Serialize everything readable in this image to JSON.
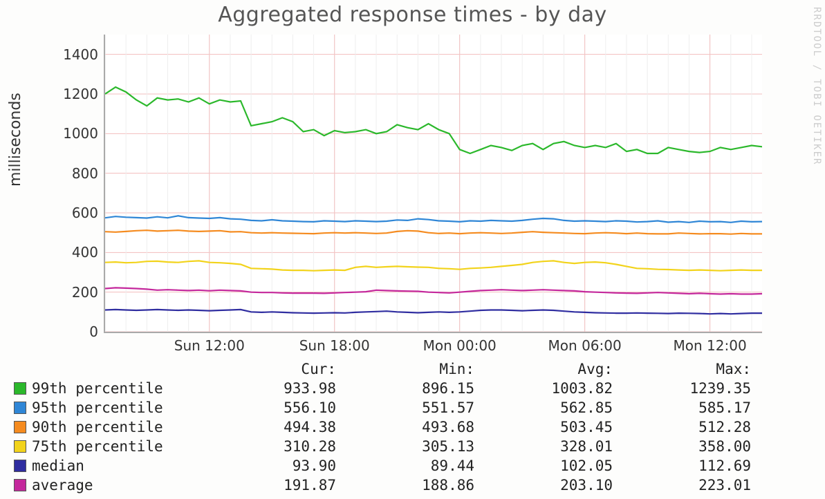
{
  "title": "Aggregated response times - by day",
  "ylabel": "milliseconds",
  "watermark": "RRDTOOL / TOBI OETIKER",
  "yticks": [
    "0",
    "200",
    "400",
    "600",
    "800",
    "1000",
    "1200",
    "1400"
  ],
  "xticks": [
    "Sun 12:00",
    "Sun 18:00",
    "Mon 00:00",
    "Mon 06:00",
    "Mon 12:00"
  ],
  "legend_header": {
    "cur": "Cur:",
    "min": "Min:",
    "avg": "Avg:",
    "max": "Max:"
  },
  "legend": [
    {
      "swatch": "#2bb82b",
      "label": "99th percentile",
      "cur": "933.98",
      "min": "896.15",
      "avg": "1003.82",
      "max": "1239.35"
    },
    {
      "swatch": "#2f86d6",
      "label": "95th percentile",
      "cur": "556.10",
      "min": "551.57",
      "avg": "562.85",
      "max": "585.17"
    },
    {
      "swatch": "#f58b1f",
      "label": "90th percentile",
      "cur": "494.38",
      "min": "493.68",
      "avg": "503.45",
      "max": "512.28"
    },
    {
      "swatch": "#f2d31b",
      "label": "75th percentile",
      "cur": "310.28",
      "min": "305.13",
      "avg": "328.01",
      "max": "358.00"
    },
    {
      "swatch": "#2f2da0",
      "label": "median",
      "cur": "93.90",
      "min": "89.44",
      "avg": "102.05",
      "max": "112.69"
    },
    {
      "swatch": "#c4289c",
      "label": "average",
      "cur": "191.87",
      "min": "188.86",
      "avg": "203.10",
      "max": "223.01"
    }
  ],
  "chart_data": {
    "type": "line",
    "xlabel": "",
    "ylabel": "milliseconds",
    "title": "Aggregated response times - by day",
    "ylim": [
      0,
      1500
    ],
    "x": [
      0,
      1,
      2,
      3,
      4,
      5,
      6,
      7,
      8,
      9,
      10,
      11,
      12,
      13,
      14,
      15,
      16,
      17,
      18,
      19,
      20,
      21,
      22,
      23,
      24,
      25,
      26,
      27,
      28,
      29,
      30,
      31,
      32,
      33,
      34,
      35,
      36,
      37,
      38,
      39,
      40,
      41,
      42,
      43,
      44,
      45,
      46,
      47,
      48,
      49,
      50,
      51,
      52,
      53,
      54,
      55,
      56,
      57,
      58,
      59,
      60,
      61,
      62,
      63
    ],
    "x_tick_positions": [
      10,
      22,
      34,
      46,
      58
    ],
    "x_tick_labels": [
      "Sun 12:00",
      "Sun 18:00",
      "Mon 00:00",
      "Mon 06:00",
      "Mon 12:00"
    ],
    "series": [
      {
        "name": "99th percentile",
        "color": "#2bb82b",
        "values": [
          1200,
          1235,
          1210,
          1170,
          1140,
          1180,
          1170,
          1175,
          1160,
          1180,
          1150,
          1170,
          1160,
          1165,
          1040,
          1050,
          1060,
          1080,
          1060,
          1010,
          1020,
          990,
          1015,
          1005,
          1010,
          1020,
          1000,
          1010,
          1045,
          1030,
          1020,
          1050,
          1020,
          1000,
          920,
          900,
          920,
          940,
          930,
          915,
          940,
          950,
          920,
          950,
          960,
          940,
          930,
          940,
          930,
          950,
          910,
          920,
          900,
          900,
          930,
          920,
          910,
          905,
          910,
          930,
          920,
          930,
          940,
          934
        ]
      },
      {
        "name": "95th percentile",
        "color": "#2f86d6",
        "values": [
          575,
          582,
          578,
          576,
          574,
          580,
          575,
          585,
          576,
          574,
          572,
          576,
          570,
          568,
          562,
          560,
          565,
          560,
          558,
          556,
          555,
          560,
          558,
          556,
          560,
          558,
          556,
          558,
          564,
          562,
          570,
          566,
          560,
          558,
          555,
          560,
          558,
          562,
          560,
          558,
          562,
          568,
          572,
          570,
          562,
          558,
          560,
          558,
          556,
          560,
          558,
          554,
          556,
          560,
          553,
          556,
          552,
          558,
          555,
          556,
          552,
          558,
          555,
          556
        ]
      },
      {
        "name": "90th percentile",
        "color": "#f58b1f",
        "values": [
          505,
          503,
          506,
          510,
          512,
          508,
          510,
          512,
          508,
          506,
          508,
          510,
          504,
          505,
          500,
          498,
          500,
          498,
          497,
          496,
          495,
          498,
          500,
          498,
          500,
          498,
          496,
          498,
          506,
          510,
          508,
          500,
          496,
          498,
          495,
          498,
          500,
          498,
          496,
          498,
          502,
          505,
          502,
          500,
          498,
          496,
          495,
          498,
          500,
          498,
          495,
          498,
          495,
          494,
          494,
          498,
          496,
          494,
          495,
          495,
          493,
          496,
          494,
          494
        ]
      },
      {
        "name": "75th percentile",
        "color": "#f2d31b",
        "values": [
          350,
          352,
          348,
          350,
          355,
          356,
          352,
          350,
          355,
          358,
          350,
          348,
          345,
          340,
          320,
          318,
          316,
          312,
          310,
          310,
          308,
          310,
          312,
          310,
          325,
          330,
          325,
          328,
          330,
          328,
          326,
          325,
          320,
          318,
          315,
          320,
          322,
          325,
          330,
          335,
          340,
          350,
          355,
          358,
          350,
          345,
          350,
          352,
          348,
          340,
          330,
          320,
          318,
          315,
          314,
          312,
          310,
          312,
          310,
          308,
          310,
          312,
          310,
          310
        ]
      },
      {
        "name": "average",
        "color": "#c4289c",
        "values": [
          218,
          222,
          220,
          218,
          215,
          210,
          212,
          210,
          208,
          210,
          207,
          210,
          208,
          206,
          200,
          198,
          198,
          196,
          195,
          195,
          195,
          194,
          196,
          198,
          200,
          202,
          210,
          208,
          206,
          205,
          204,
          200,
          198,
          196,
          200,
          204,
          208,
          210,
          212,
          210,
          208,
          210,
          212,
          210,
          208,
          206,
          202,
          200,
          198,
          196,
          195,
          194,
          196,
          198,
          196,
          194,
          192,
          194,
          192,
          190,
          192,
          190,
          190,
          192
        ]
      },
      {
        "name": "median",
        "color": "#2f2da0",
        "values": [
          110,
          112,
          110,
          108,
          110,
          112,
          110,
          108,
          110,
          108,
          106,
          108,
          110,
          112,
          100,
          98,
          100,
          98,
          96,
          95,
          94,
          95,
          96,
          95,
          98,
          100,
          102,
          104,
          100,
          98,
          96,
          98,
          100,
          98,
          100,
          104,
          108,
          110,
          110,
          108,
          106,
          108,
          110,
          108,
          104,
          100,
          98,
          96,
          95,
          94,
          94,
          95,
          94,
          93,
          92,
          94,
          93,
          92,
          90,
          92,
          90,
          92,
          94,
          94
        ]
      }
    ]
  }
}
